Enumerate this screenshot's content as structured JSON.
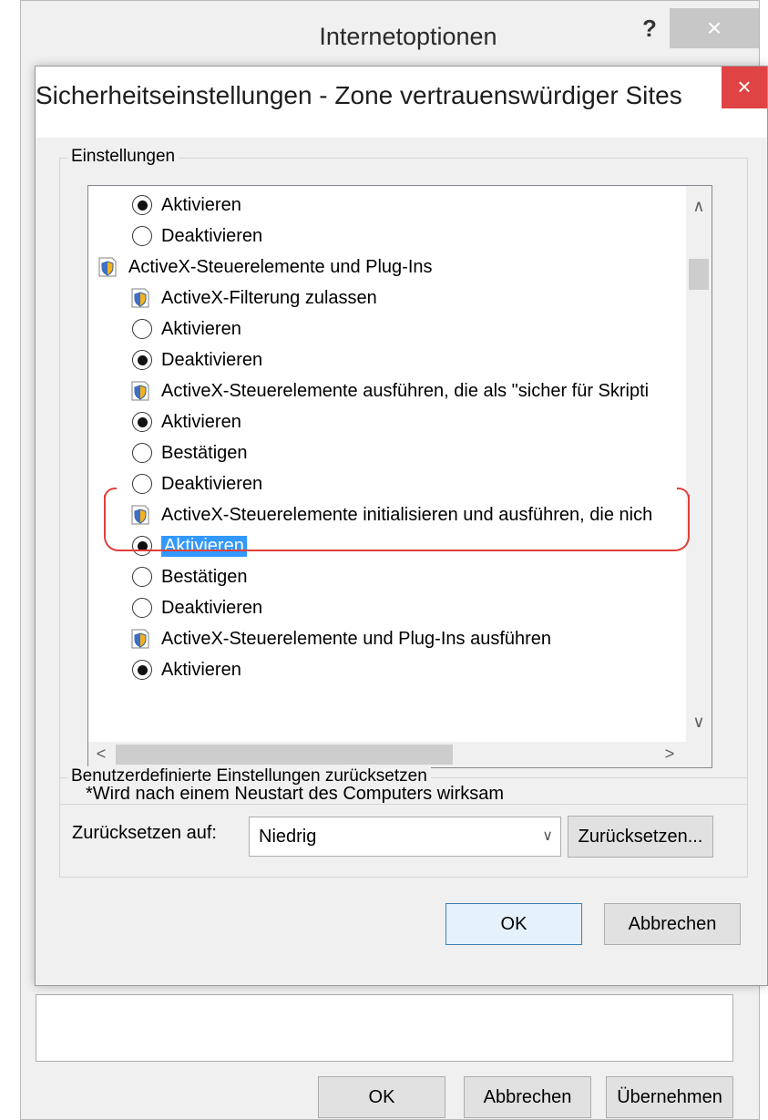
{
  "background_window": {
    "title": "Internetoptionen",
    "help_label": "?",
    "close_label": "×",
    "buttons": {
      "ok": "OK",
      "cancel": "Abbrechen",
      "apply": "Übernehmen"
    }
  },
  "dialog": {
    "title": "Sicherheitseinstellungen - Zone vertrauenswürdiger Sites",
    "close_label": "×",
    "settings_group_label": "Einstellungen",
    "tree_items": [
      {
        "type": "radio",
        "label": "Aktivieren",
        "checked": true,
        "selected": false,
        "indent": 1
      },
      {
        "type": "radio",
        "label": "Deaktivieren",
        "checked": false,
        "selected": false,
        "indent": 1
      },
      {
        "type": "category",
        "label": "ActiveX-Steuerelemente und Plug-Ins",
        "indent": 0
      },
      {
        "type": "category",
        "label": "ActiveX-Filterung zulassen",
        "indent": 1
      },
      {
        "type": "radio",
        "label": "Aktivieren",
        "checked": false,
        "selected": false,
        "indent": 1
      },
      {
        "type": "radio",
        "label": "Deaktivieren",
        "checked": true,
        "selected": false,
        "indent": 1
      },
      {
        "type": "category",
        "label": "ActiveX-Steuerelemente ausführen, die als \"sicher für Skripti",
        "indent": 1
      },
      {
        "type": "radio",
        "label": "Aktivieren",
        "checked": true,
        "selected": false,
        "indent": 1
      },
      {
        "type": "radio",
        "label": "Bestätigen",
        "checked": false,
        "selected": false,
        "indent": 1
      },
      {
        "type": "radio",
        "label": "Deaktivieren",
        "checked": false,
        "selected": false,
        "indent": 1
      },
      {
        "type": "category",
        "label": "ActiveX-Steuerelemente initialisieren und ausführen, die nich",
        "indent": 1
      },
      {
        "type": "radio",
        "label": "Aktivieren",
        "checked": true,
        "selected": true,
        "indent": 1
      },
      {
        "type": "radio",
        "label": "Bestätigen",
        "checked": false,
        "selected": false,
        "indent": 1
      },
      {
        "type": "radio",
        "label": "Deaktivieren",
        "checked": false,
        "selected": false,
        "indent": 1
      },
      {
        "type": "category",
        "label": "ActiveX-Steuerelemente und Plug-Ins ausführen",
        "indent": 1
      },
      {
        "type": "radio",
        "label": "Aktivieren",
        "checked": true,
        "selected": false,
        "indent": 1
      }
    ],
    "scroll_up": "∧",
    "scroll_down": "∨",
    "scroll_left": "<",
    "scroll_right": ">",
    "restart_note": "*Wird nach einem Neustart des Computers wirksam",
    "reset_group_label": "Benutzerdefinierte Einstellungen zurücksetzen",
    "reset_to_label": "Zurücksetzen auf:",
    "reset_level_value": "Niedrig",
    "combo_arrow": "∨",
    "reset_button": "Zurücksetzen...",
    "ok_button": "OK",
    "cancel_button": "Abbrechen"
  }
}
